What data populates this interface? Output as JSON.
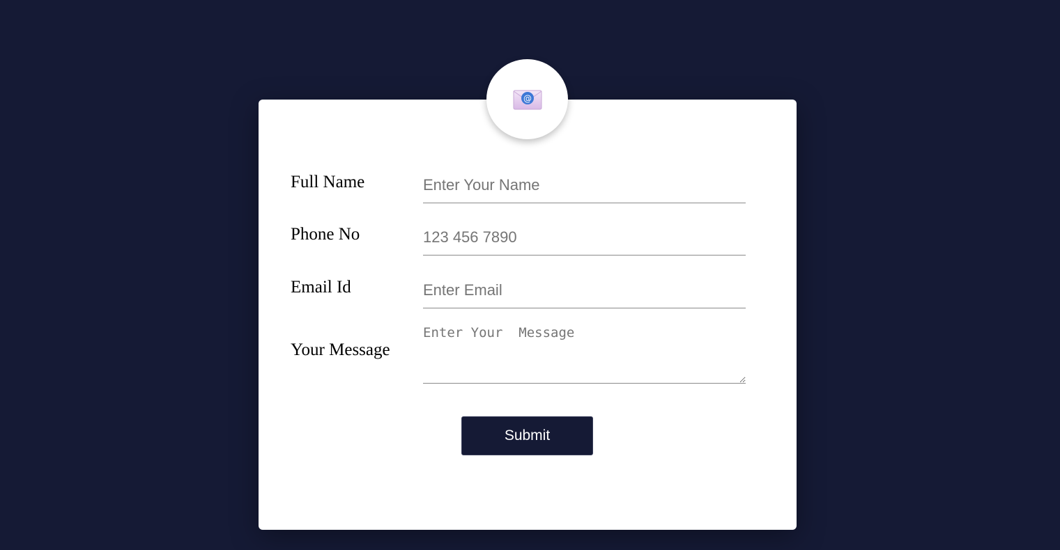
{
  "form": {
    "icon": "email-envelope-icon",
    "fields": [
      {
        "label": "Full Name",
        "placeholder": "Enter Your Name"
      },
      {
        "label": "Phone No",
        "placeholder": "123 456 7890"
      },
      {
        "label": "Email Id",
        "placeholder": "Enter Email"
      },
      {
        "label": "Your Message",
        "placeholder": "Enter Your  Message"
      }
    ],
    "submit_label": "Submit"
  },
  "colors": {
    "background": "#151a35",
    "card": "#ffffff",
    "button": "#151a35",
    "button_text": "#ffffff",
    "envelope_blue": "#3d78d6",
    "envelope_pink": "#e9d5f0"
  }
}
